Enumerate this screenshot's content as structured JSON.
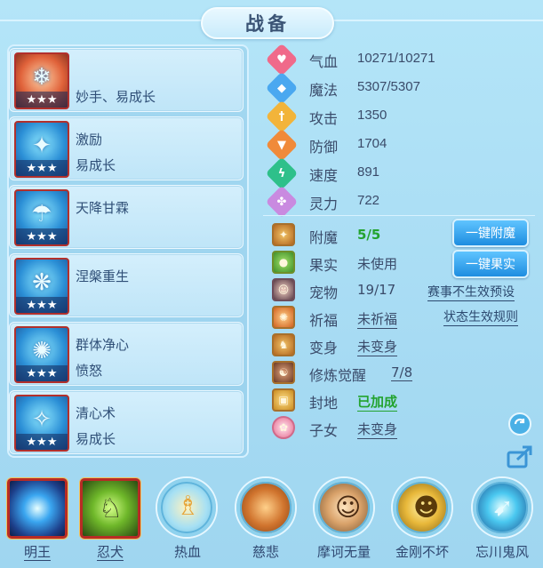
{
  "title": "战备",
  "skills": [
    {
      "name": "",
      "sub": "妙手、易成长",
      "stars": "★★★",
      "icon": "popsicle-icon"
    },
    {
      "name": "激励",
      "sub": "易成长",
      "stars": "★★★",
      "icon": "inspire-icon"
    },
    {
      "name": "天降甘霖",
      "sub": "",
      "stars": "★★★",
      "icon": "rain-icon"
    },
    {
      "name": "涅槃重生",
      "sub": "",
      "stars": "★★★",
      "icon": "rebirth-icon"
    },
    {
      "name": "群体净心",
      "sub": "愤怒",
      "stars": "★★★",
      "icon": "purify-icon"
    },
    {
      "name": "清心术",
      "sub": "易成长",
      "stars": "★★★",
      "icon": "clear-mind-icon"
    }
  ],
  "stats": [
    {
      "label": "气血",
      "value": "10271/10271",
      "icon": "heart-icon",
      "color": "#f06a8a"
    },
    {
      "label": "魔法",
      "value": "5307/5307",
      "icon": "mana-icon",
      "color": "#4aa8f0"
    },
    {
      "label": "攻击",
      "value": "1350",
      "icon": "sword-icon",
      "color": "#f2b43a"
    },
    {
      "label": "防御",
      "value": "1704",
      "icon": "shield-icon",
      "color": "#f08a3a"
    },
    {
      "label": "速度",
      "value": "891",
      "icon": "speed-icon",
      "color": "#2ec08a"
    },
    {
      "label": "灵力",
      "value": "722",
      "icon": "spirit-icon",
      "color": "#c98ae0"
    }
  ],
  "misc": {
    "enchant": {
      "label": "附魔",
      "value": "5/5"
    },
    "fruit": {
      "label": "果实",
      "value": "未使用"
    },
    "pet": {
      "label": "宠物",
      "value": "19/17"
    },
    "bless": {
      "label": "祈福",
      "value": "未祈福"
    },
    "transform": {
      "label": "变身",
      "value": "未变身"
    },
    "cultivate": {
      "label": "修炼觉醒",
      "value": "7/8"
    },
    "fief": {
      "label": "封地",
      "value": "已加成"
    },
    "child": {
      "label": "子女",
      "value": "未变身"
    }
  },
  "buttons": {
    "one_click_enchant": "一键附魔",
    "one_click_fruit": "一键果实"
  },
  "links": {
    "event_preset": "赛事不生效预设",
    "status_rules": "状态生效规则"
  },
  "bottom_skills": [
    {
      "label": "明王",
      "icon": "ming-wang-icon"
    },
    {
      "label": "忍犬",
      "icon": "ninja-dog-icon"
    },
    {
      "label": "热血",
      "icon": "hot-blood-icon"
    },
    {
      "label": "慈悲",
      "icon": "mercy-icon"
    },
    {
      "label": "摩诃无量",
      "icon": "mohe-icon"
    },
    {
      "label": "金刚不坏",
      "icon": "vajra-icon"
    },
    {
      "label": "忘川鬼风",
      "icon": "ghost-wind-icon"
    }
  ]
}
